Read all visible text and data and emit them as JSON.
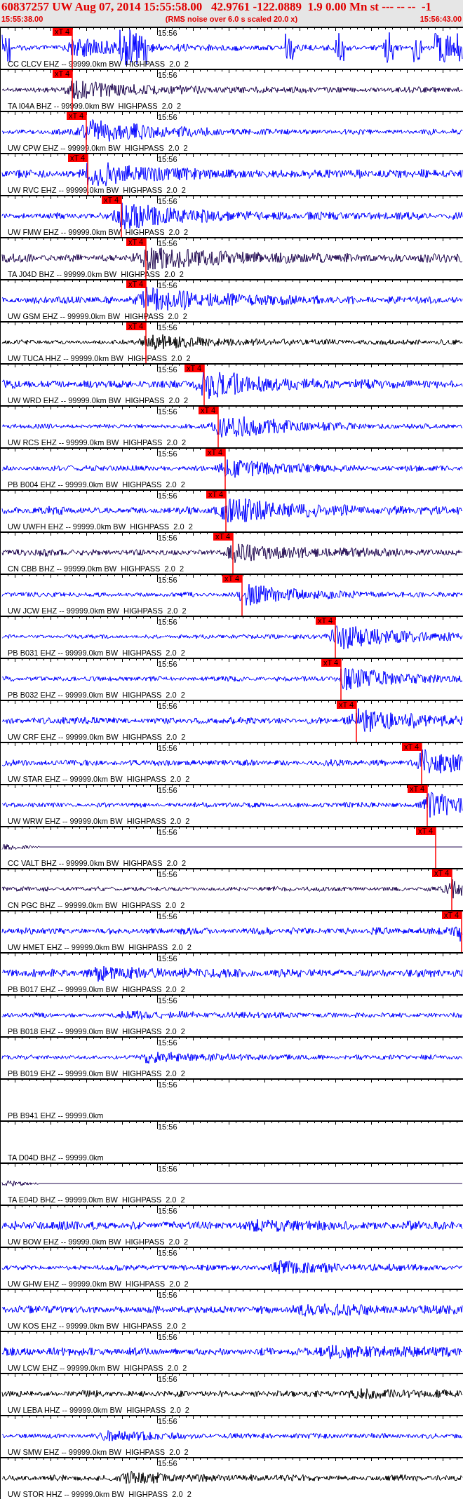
{
  "header": {
    "title": "60837257 UW Aug 07, 2014 15:55:58.00   42.9761 -122.0889  1.9 0.00 Mn st --- -- --  -1",
    "start_time": "15:55:38.00",
    "note": "(RMS noise over 6.0 s scaled 20.0 x)",
    "end_time": "15:56:43.00"
  },
  "traces": [
    {
      "kind": "waveform",
      "color": "#0000ff",
      "time_label": "15:56",
      "pick": {
        "label": "xT 4"
      },
      "label": "CC CLCV EHZ -- 99999.0km BW  HIGHPASS  2.0  2"
    },
    {
      "kind": "waveform",
      "color": "#200850",
      "time_label": "15:56",
      "pick": {
        "label": "xT 4"
      },
      "label": "TA I04A BHZ -- 99999.0km BW  HIGHPASS  2.0  2"
    },
    {
      "kind": "waveform",
      "color": "#0000ff",
      "time_label": "15:56",
      "pick": {
        "label": "xT 4"
      },
      "label": "UW CPW EHZ -- 99999.0km BW  HIGHPASS  2.0  2"
    },
    {
      "kind": "waveform",
      "color": "#0000ff",
      "time_label": "15:56",
      "pick": {
        "label": "xT 4"
      },
      "label": "UW RVC EHZ -- 99999.0km BW  HIGHPASS  2.0  2"
    },
    {
      "kind": "waveform",
      "color": "#0000ff",
      "time_label": "15:56",
      "pick": {
        "label": "xT 4"
      },
      "label": "UW FMW EHZ -- 99999.0km BW  HIGHPASS  2.0  2"
    },
    {
      "kind": "waveform",
      "color": "#200850",
      "time_label": "15:56",
      "pick": {
        "label": "xT 4"
      },
      "label": "TA J04D BHZ -- 99999.0km BW  HIGHPASS  2.0  2"
    },
    {
      "kind": "waveform",
      "color": "#0000ff",
      "time_label": "15:56",
      "pick": {
        "label": "xT 4"
      },
      "label": "UW GSM EHZ -- 99999.0km BW  HIGHPASS  2.0  2"
    },
    {
      "kind": "waveform",
      "color": "#000000",
      "time_label": "15:56",
      "pick": {
        "label": "xT 4"
      },
      "label": "UW TUCA HHZ -- 99999.0km BW  HIGHPASS  2.0  2"
    },
    {
      "kind": "waveform",
      "color": "#0000ff",
      "time_label": "15:56",
      "pick": {
        "label": "xT 4"
      },
      "label": "UW WRD EHZ -- 99999.0km BW  HIGHPASS  2.0  2"
    },
    {
      "kind": "waveform",
      "color": "#0000ff",
      "time_label": "15:56",
      "pick": {
        "label": "xT 4"
      },
      "label": "UW RCS EHZ -- 99999.0km BW  HIGHPASS  2.0  2"
    },
    {
      "kind": "waveform",
      "color": "#0000ff",
      "time_label": "15:56",
      "pick": {
        "label": "xT 4"
      },
      "label": "PB B004 EHZ -- 99999.0km BW  HIGHPASS  2.0  2"
    },
    {
      "kind": "waveform",
      "color": "#0000ff",
      "time_label": "15:56",
      "pick": {
        "label": "xT 4"
      },
      "label": "UW UWFH EHZ -- 99999.0km BW  HIGHPASS  2.0  2"
    },
    {
      "kind": "waveform",
      "color": "#200850",
      "time_label": "15:56",
      "pick": {
        "label": "xT 4"
      },
      "label": "CN CBB BHZ -- 99999.0km BW  HIGHPASS  2.0  2"
    },
    {
      "kind": "waveform",
      "color": "#0000ff",
      "time_label": "15:56",
      "pick": {
        "label": "xT 4"
      },
      "label": "UW JCW EHZ -- 99999.0km BW  HIGHPASS  2.0  2"
    },
    {
      "kind": "waveform",
      "color": "#0000ff",
      "time_label": "15:56",
      "pick": {
        "label": "xT 4"
      },
      "label": "PB B031 EHZ -- 99999.0km BW  HIGHPASS  2.0  2"
    },
    {
      "kind": "waveform",
      "color": "#0000ff",
      "time_label": "15:56",
      "pick": {
        "label": "xT 4"
      },
      "label": "PB B032 EHZ -- 99999.0km BW  HIGHPASS  2.0  2"
    },
    {
      "kind": "waveform",
      "color": "#0000ff",
      "time_label": "15:56",
      "pick": {
        "label": "xT 4"
      },
      "label": "UW CRF EHZ -- 99999.0km BW  HIGHPASS  2.0  2"
    },
    {
      "kind": "waveform",
      "color": "#0000ff",
      "time_label": "15:56",
      "pick": {
        "label": "xT 4"
      },
      "label": "UW STAR EHZ -- 99999.0km BW  HIGHPASS  2.0  2"
    },
    {
      "kind": "waveform",
      "color": "#0000ff",
      "time_label": "15:56",
      "pick": {
        "label": "xT 4"
      },
      "label": "UW WRW EHZ -- 99999.0km BW  HIGHPASS  2.0  2"
    },
    {
      "kind": "dead",
      "color": "#200850",
      "time_label": "15:56",
      "pick": {
        "label": "xT 4"
      },
      "label": "CC VALT BHZ -- 99999.0km BW  HIGHPASS  2.0  2"
    },
    {
      "kind": "waveform",
      "color": "#200850",
      "time_label": "15:56",
      "pick": {
        "label": "xT 4"
      },
      "label": "CN PGC BHZ -- 99999.0km BW  HIGHPASS  2.0  2"
    },
    {
      "kind": "waveform",
      "color": "#0000ff",
      "time_label": "15:56",
      "pick": {
        "label": "xT 4"
      },
      "label": "UW HMET EHZ -- 99999.0km BW  HIGHPASS  2.0  2"
    },
    {
      "kind": "waveform",
      "color": "#0000ff",
      "time_label": "15:56",
      "label": "PB B017 EHZ -- 99999.0km BW  HIGHPASS  2.0  2"
    },
    {
      "kind": "waveform",
      "color": "#0000ff",
      "time_label": "15:56",
      "label": "PB B018 EHZ -- 99999.0km BW  HIGHPASS  2.0  2"
    },
    {
      "kind": "waveform",
      "color": "#0000ff",
      "time_label": "15:56",
      "label": "PB B019 EHZ -- 99999.0km BW  HIGHPASS  2.0  2"
    },
    {
      "kind": "none",
      "time_label": "15:56",
      "label": "PB B941 EHZ -- 99999.0km"
    },
    {
      "kind": "none",
      "time_label": "15:56",
      "label": "TA D04D BHZ -- 99999.0km"
    },
    {
      "kind": "dead",
      "color": "#200850",
      "time_label": "15:56",
      "label": "TA E04D BHZ -- 99999.0km BW  HIGHPASS  2.0  2"
    },
    {
      "kind": "waveform",
      "color": "#0000ff",
      "time_label": "15:56",
      "label": "UW BOW EHZ -- 99999.0km BW  HIGHPASS  2.0  2"
    },
    {
      "kind": "waveform",
      "color": "#0000ff",
      "time_label": "15:56",
      "label": "UW GHW EHZ -- 99999.0km BW  HIGHPASS  2.0  2"
    },
    {
      "kind": "waveform",
      "color": "#0000ff",
      "time_label": "15:56",
      "label": "UW KOS EHZ -- 99999.0km BW  HIGHPASS  2.0  2"
    },
    {
      "kind": "waveform",
      "color": "#0000ff",
      "time_label": "15:56",
      "label": "UW LCW EHZ -- 99999.0km BW  HIGHPASS  2.0  2"
    },
    {
      "kind": "waveform",
      "color": "#000000",
      "time_label": "15:56",
      "label": "UW LEBA HHZ -- 99999.0km BW  HIGHPASS  2.0  2"
    },
    {
      "kind": "waveform",
      "color": "#0000ff",
      "time_label": "15:56",
      "label": "UW SMW EHZ -- 99999.0km BW  HIGHPASS  2.0  2"
    },
    {
      "kind": "waveform",
      "color": "#000000",
      "time_label": "15:56",
      "label": "UW STOR HHZ -- 99999.0km BW  HIGHPASS  2.0  2"
    }
  ]
}
